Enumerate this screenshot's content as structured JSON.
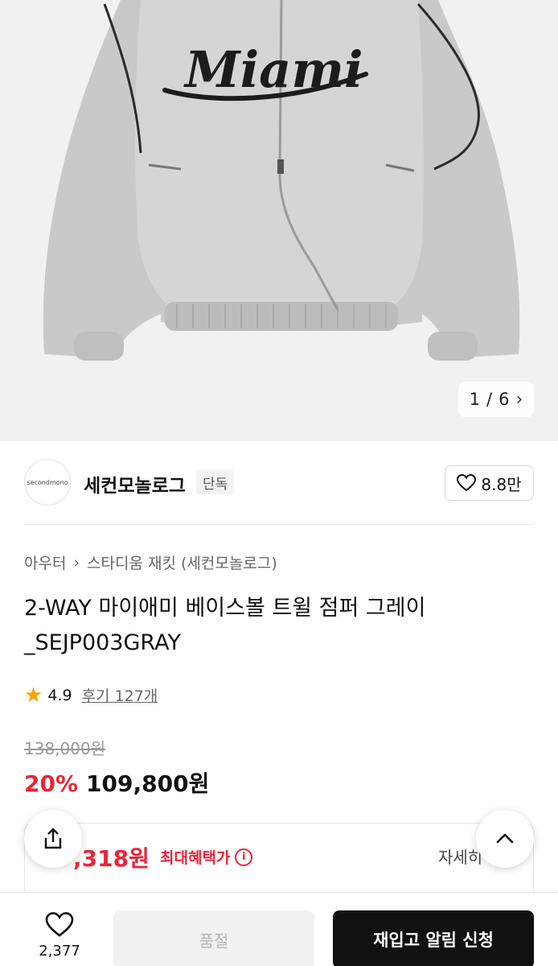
{
  "image": {
    "counter_current": "1",
    "counter_total": "6",
    "separator": "/",
    "next_icon": "chevron-right-icon",
    "jacket_script": "Miami"
  },
  "brand": {
    "logo_text": "secondmono",
    "name": "세컨모놀로그",
    "badge": "단독",
    "like_count": "8.8만"
  },
  "breadcrumb": [
    "아우터",
    "스타디움 재킷 (세컨모놀로그)"
  ],
  "product": {
    "title": "2-WAY 마이애미 베이스볼 트윌 점퍼 그레이_SEJP003GRAY",
    "rating": "4.9",
    "review_text": "후기 127개",
    "original_price": "138,000원",
    "discount": "20%",
    "price": "109,800원"
  },
  "benefit": {
    "price_partial": ",318원",
    "label": "최대혜택가",
    "detail": "자세히"
  },
  "bottom_bar": {
    "wish_count": "2,377",
    "soldout_label": "품절",
    "restock_label": "재입고 알림 신청"
  },
  "colors": {
    "accent_red": "#e8253a",
    "star": "#f2a500",
    "primary_button": "#111111"
  }
}
